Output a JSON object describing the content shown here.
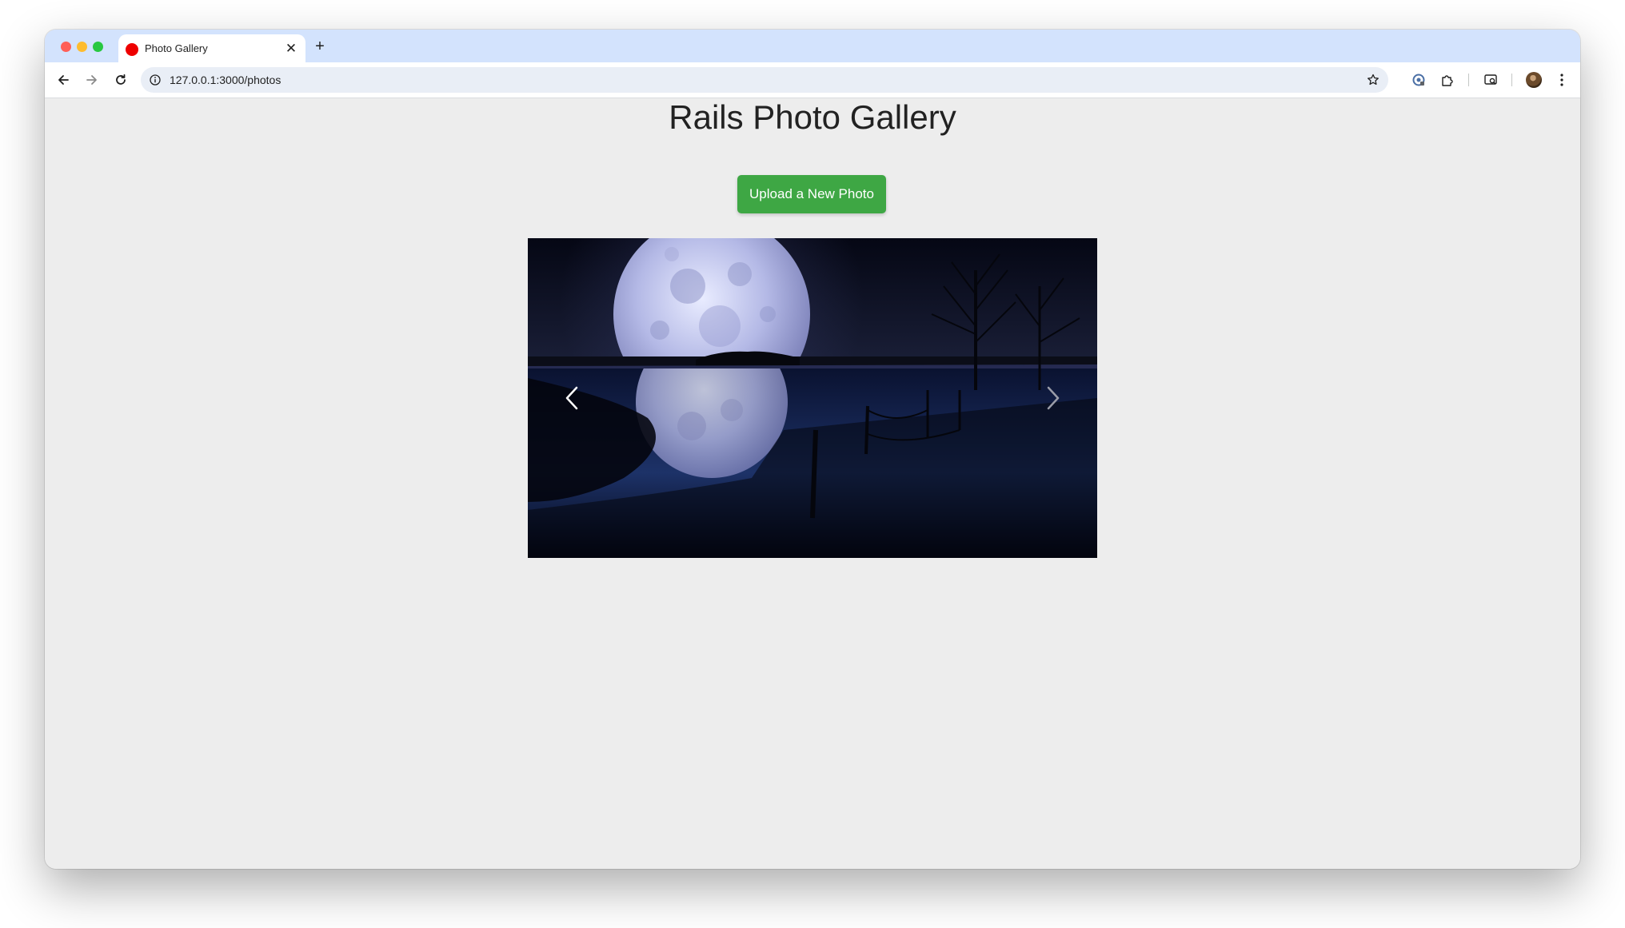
{
  "browser": {
    "tab": {
      "title": "Photo Gallery",
      "favicon_color": "#ee0000",
      "close_icon": "close-icon"
    },
    "new_tab_icon": "plus-icon",
    "address_bar": {
      "url": "127.0.0.1:3000/photos",
      "info_icon": "info-icon",
      "bookmark_icon": "star-icon"
    },
    "toolbar_icons": [
      "back-arrow-icon",
      "forward-arrow-icon",
      "reload-icon",
      "google-lens-icon",
      "extensions-puzzle-icon",
      "tab-search-icon",
      "profile-avatar",
      "kebab-menu-icon"
    ]
  },
  "page": {
    "title": "Rails Photo Gallery",
    "upload_button": "Upload a New Photo",
    "upload_button_color": "#3ea744",
    "background_color": "#ededed"
  },
  "carousel": {
    "photo": "full-moon-over-water-reflection",
    "prev_icon": "chevron-left-icon",
    "next_icon": "chevron-right-icon"
  }
}
